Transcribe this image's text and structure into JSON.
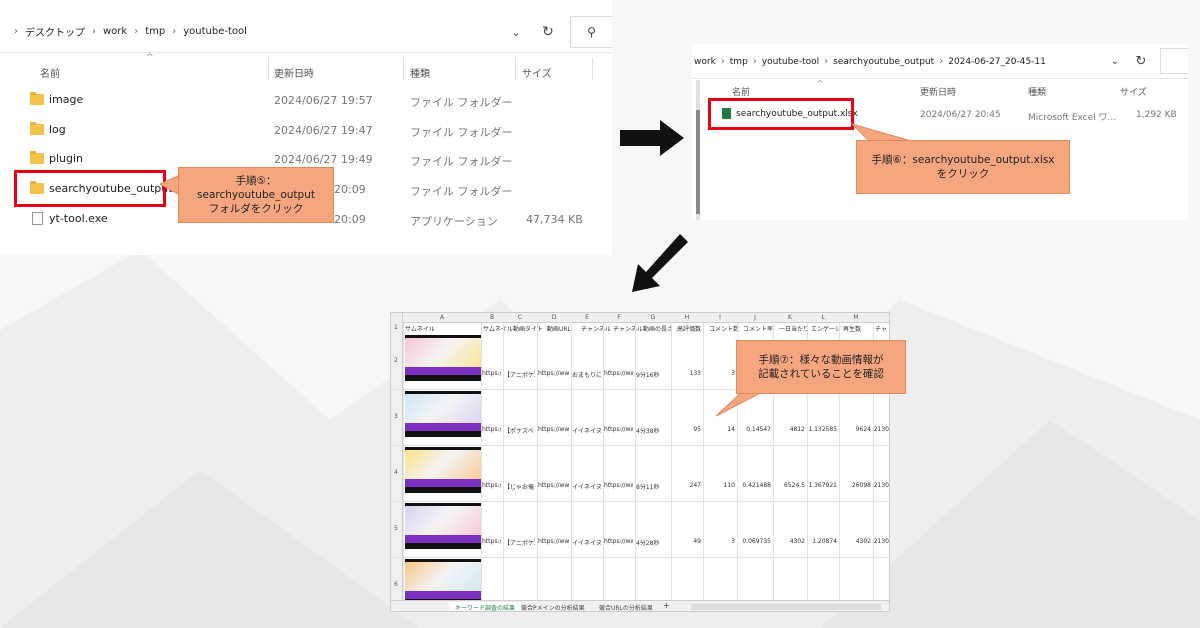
{
  "explorer1": {
    "breadcrumb": [
      "デスクトップ",
      "work",
      "tmp",
      "youtube-tool"
    ],
    "columns": [
      "名前",
      "更新日時",
      "種類",
      "サイズ"
    ],
    "rows": [
      {
        "name": "image",
        "date": "2024/06/27 19:57",
        "type": "ファイル フォルダー",
        "size": ""
      },
      {
        "name": "log",
        "date": "2024/06/27 19:47",
        "type": "ファイル フォルダー",
        "size": ""
      },
      {
        "name": "plugin",
        "date": "2024/06/27 19:49",
        "type": "ファイル フォルダー",
        "size": ""
      },
      {
        "name": "searchyoutube_output",
        "date": "20:09",
        "type": "ファイル フォルダー",
        "size": ""
      },
      {
        "name": "yt-tool.exe",
        "date": "20:09",
        "type": "アプリケーション",
        "size": "47,734 KB"
      }
    ]
  },
  "callout5": {
    "line1": "手順⑤：",
    "line2": "searchyoutube_output",
    "line3": "フォルダをクリック"
  },
  "explorer2": {
    "breadcrumb": [
      "work",
      "tmp",
      "youtube-tool",
      "searchyoutube_output",
      "2024-06-27_20-45-11"
    ],
    "columns": [
      "名前",
      "更新日時",
      "種類",
      "サイズ"
    ],
    "rows": [
      {
        "name": "searchyoutube_output.xlsx",
        "date": "2024/06/27 20:45",
        "type": "Microsoft Excel ワ...",
        "size": "1,292 KB"
      }
    ]
  },
  "callout6": {
    "line1": "手順⑥：searchyoutube_output.xlsx",
    "line2": "をクリック"
  },
  "callout7": {
    "line1": "手順⑦：様々な動画情報が",
    "line2": "記載されていることを確認"
  },
  "excel": {
    "col_letters": [
      "A",
      "B",
      "C",
      "D",
      "E",
      "F",
      "G",
      "H",
      "I",
      "J",
      "K",
      "L",
      "M"
    ],
    "headers": [
      "サムネイル",
      "サムネイル",
      "動画タイト",
      "動画URL",
      "チャンネル",
      "チャンネル",
      "動画の長さ",
      "高評価数",
      "コメント数",
      "コメント率",
      "一日当たり",
      "エンゲージ",
      "再生数",
      "チャ"
    ],
    "rows": [
      {
        "num": "2",
        "cells": [
          "https://i.y",
          "【アニポケ】",
          "https://ww",
          "おまもりに",
          "https://ww",
          "9分16秒",
          "133",
          "3",
          "",
          "",
          "",
          ""
        ]
      },
      {
        "num": "3",
        "cells": [
          "https://i.y",
          "【ポケスペ",
          "https://ww",
          "イイネイヌ",
          "https://ww",
          "4分38秒",
          "95",
          "14",
          "0.14547",
          "4812",
          "1.132585",
          "9624",
          "2130"
        ]
      },
      {
        "num": "4",
        "cells": [
          "https://i.y",
          "【じゃお俺",
          "https://ww",
          "イイネイヌ",
          "https://ww",
          "8分11秒",
          "247",
          "110",
          "0.421488",
          "6524.5",
          "1.367921",
          "26098",
          "2130"
        ]
      },
      {
        "num": "5",
        "cells": [
          "https://i.y",
          "【アニポケ】",
          "https://ww",
          "イイネイヌ",
          "https://ww",
          "4分28秒",
          "49",
          "3",
          "0.069735",
          "4302",
          "1.20874",
          "4302",
          "2130"
        ]
      },
      {
        "num": "6",
        "cells": []
      }
    ],
    "sheets": [
      "キーワード調査の結果",
      "競合Pメインの分析結果",
      "競合URLの分析結果",
      "+"
    ]
  }
}
